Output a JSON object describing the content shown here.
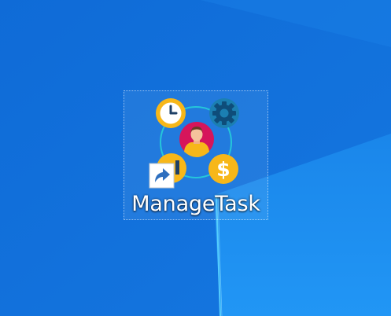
{
  "desktop": {
    "wallpaper_colors": {
      "base": "#1373dd",
      "light_panel": "#1d8ff0",
      "beam": "#5fd8ff"
    },
    "icons": [
      {
        "label": "ManageTask",
        "icon": "manage-task-app-icon",
        "selected": true,
        "shortcut_overlay": "shortcut-arrow-icon",
        "colors": {
          "clock": "#f7b719",
          "gear": "#1b7fb2",
          "person_circle": "#d6155b",
          "dollar": "#f7b719",
          "ring": "#25c6da"
        }
      }
    ]
  }
}
